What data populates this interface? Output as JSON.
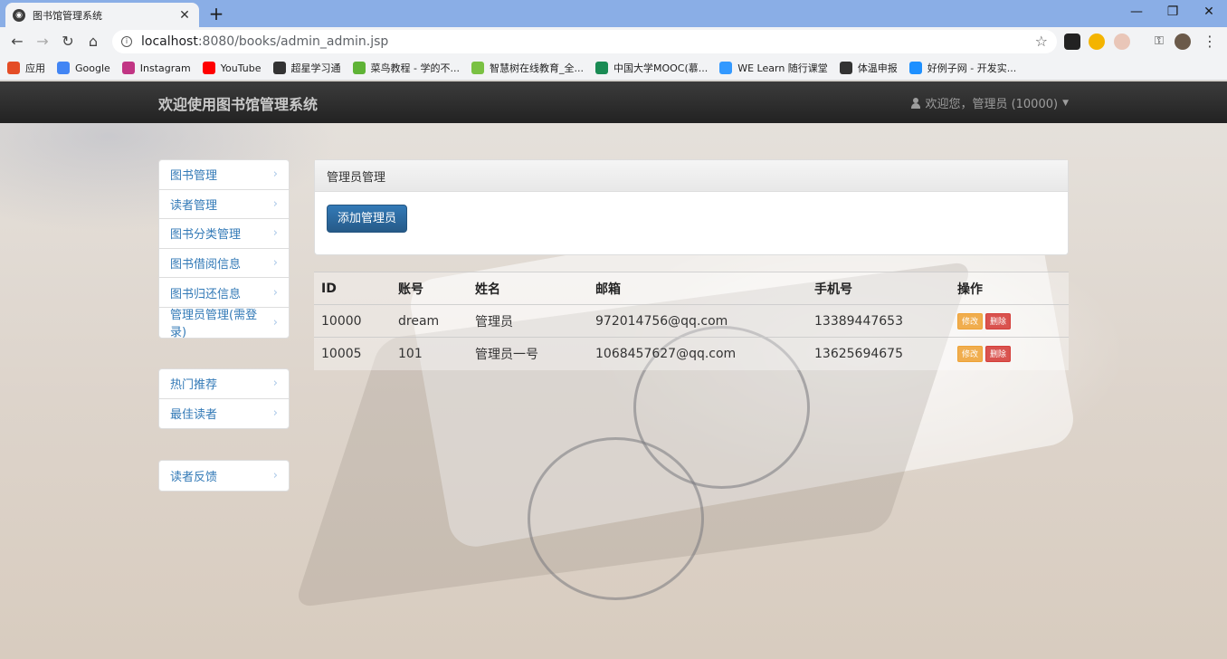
{
  "browser": {
    "tab_title": "图书馆管理系统",
    "new_tab": "+",
    "url_host": "localhost",
    "url_rest": ":8080/books/admin_admin.jsp",
    "bookmarks": [
      {
        "label": "应用",
        "icon": "apps-grid-icon",
        "color": "#e44d26"
      },
      {
        "label": "Google",
        "icon": "google-icon",
        "color": "#4285f4"
      },
      {
        "label": "Instagram",
        "icon": "instagram-icon",
        "color": "#c13584"
      },
      {
        "label": "YouTube",
        "icon": "youtube-icon",
        "color": "#ff0000"
      },
      {
        "label": "超星学习通",
        "icon": "globe-icon",
        "color": "#333333"
      },
      {
        "label": "菜鸟教程 - 学的不...",
        "icon": "runoob-icon",
        "color": "#5fb336"
      },
      {
        "label": "智慧树在线教育_全...",
        "icon": "zhihuishu-icon",
        "color": "#7ac143"
      },
      {
        "label": "中国大学MOOC(慕...",
        "icon": "mooc-icon",
        "color": "#1a8b54"
      },
      {
        "label": "WE Learn 随行课堂",
        "icon": "welearn-icon",
        "color": "#3399ff"
      },
      {
        "label": "体温申报",
        "icon": "globe-icon",
        "color": "#333333"
      },
      {
        "label": "好例子网 - 开发实...",
        "icon": "haolizi-icon",
        "color": "#1e90ff"
      }
    ]
  },
  "app": {
    "brand": "欢迎使用图书馆管理系统",
    "user_label": "欢迎您，管理员 (10000)",
    "menu_main": [
      "图书管理",
      "读者管理",
      "图书分类管理",
      "图书借阅信息",
      "图书归还信息",
      "管理员管理(需登录)"
    ],
    "menu_hot": [
      "热门推荐",
      "最佳读者"
    ],
    "menu_feedback": [
      "读者反馈"
    ],
    "panel_title": "管理员管理",
    "add_button": "添加管理员",
    "table": {
      "headers": [
        "ID",
        "账号",
        "姓名",
        "邮箱",
        "手机号",
        "操作"
      ],
      "rows": [
        {
          "id": "10000",
          "account": "dream",
          "name": "管理员",
          "email": "972014756@qq.com",
          "phone": "13389447653"
        },
        {
          "id": "10005",
          "account": "101",
          "name": "管理员一号",
          "email": "1068457627@qq.com",
          "phone": "13625694675"
        }
      ],
      "edit_label": "修改",
      "delete_label": "删除"
    }
  }
}
